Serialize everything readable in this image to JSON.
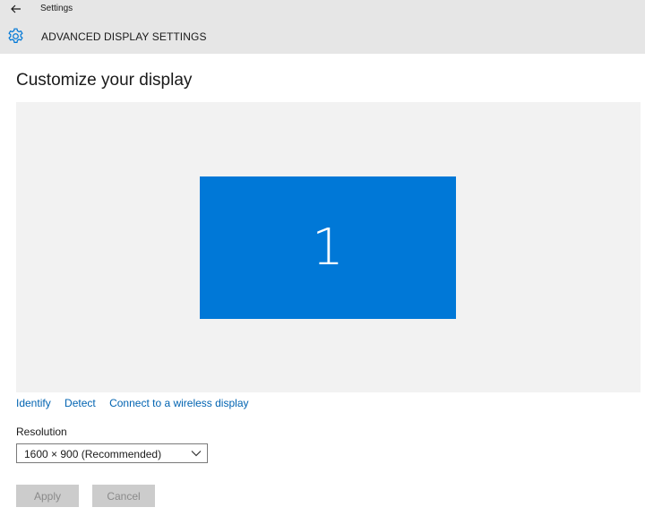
{
  "window": {
    "title": "Settings",
    "back_icon": "back-arrow-icon"
  },
  "header": {
    "icon": "gear-icon",
    "title": "ADVANCED DISPLAY SETTINGS"
  },
  "page": {
    "title": "Customize your display"
  },
  "display": {
    "monitor_number": "1",
    "monitor_color": "#0078d7",
    "area_color": "#f2f2f2"
  },
  "links": {
    "identify": "Identify",
    "detect": "Detect",
    "wireless": "Connect to a wireless display"
  },
  "resolution": {
    "label": "Resolution",
    "selected": "1600 × 900 (Recommended)"
  },
  "buttons": {
    "apply": "Apply",
    "cancel": "Cancel"
  },
  "colors": {
    "accent": "#0078d7",
    "link": "#0063b1",
    "header_bg": "#e6e6e6"
  }
}
